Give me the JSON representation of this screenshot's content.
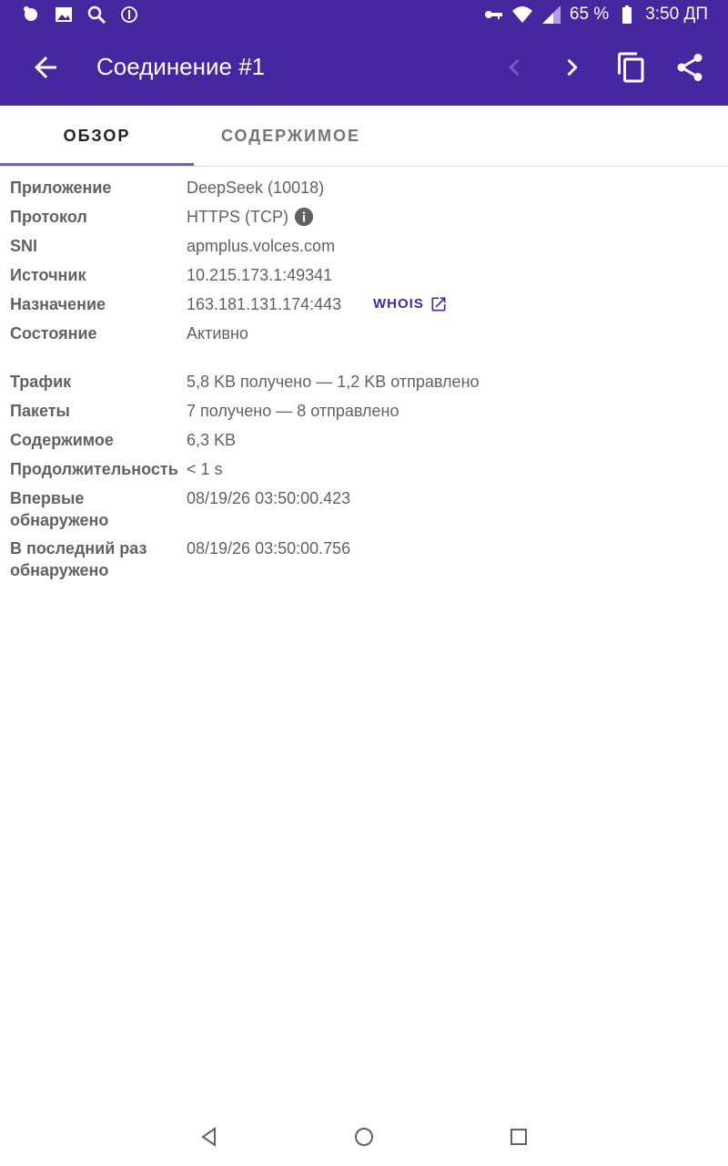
{
  "status_bar": {
    "battery": "65 %",
    "time": "3:50 ДП"
  },
  "app_bar": {
    "title": "Соединение #1"
  },
  "tabs": [
    {
      "label": "ОБЗОР"
    },
    {
      "label": "СОДЕРЖИМОЕ"
    }
  ],
  "details": {
    "app_label": "Приложение",
    "app_value": "DeepSeek (10018)",
    "protocol_label": "Протокол",
    "protocol_value": "HTTPS (TCP)",
    "sni_label": "SNI",
    "sni_value": "apmplus.volces.com",
    "source_label": "Источник",
    "source_value": "10.215.173.1:49341",
    "dest_label": "Назначение",
    "dest_value": "163.181.131.174:443",
    "whois_label": "WHOIS",
    "state_label": "Состояние",
    "state_value": "Активно",
    "traffic_label": "Трафик",
    "traffic_value": "5,8 KB получено — 1,2 KB отправлено",
    "packets_label": "Пакеты",
    "packets_value": "7 получено — 8 отправлено",
    "content_label": "Содержимое",
    "content_value": "6,3 KB",
    "duration_label": "Продолжительность",
    "duration_value": "< 1 s",
    "first_seen_label_1": "Впервые",
    "first_seen_label_2": "обнаружено",
    "first_seen_value": "08/19/26 03:50:00.423",
    "last_seen_label_1": "В последний раз",
    "last_seen_label_2": "обнаружено",
    "last_seen_value": "08/19/26 03:50:00.756"
  },
  "colors": {
    "primary": "#4527a0",
    "accent": "#7e57c2",
    "text_secondary": "#616161"
  }
}
